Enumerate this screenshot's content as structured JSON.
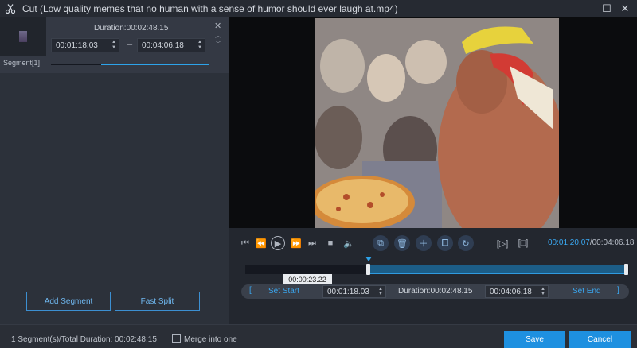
{
  "window": {
    "title": "Cut (Low quality memes that no human with a sense of humor should ever laugh at.mp4)",
    "app_icon": "scissors-icon",
    "minimize": "–",
    "maximize": "☐",
    "close": "✕"
  },
  "segment": {
    "label": "Segment[1]",
    "duration": "Duration:00:02:48.15",
    "start_time": "00:01:18.03",
    "end_time": "00:04:06.18",
    "separator": "–",
    "close": "✕",
    "up": "︿",
    "down": "﹀",
    "progress_fraction_start": 0.32,
    "progress_fraction_end": 1.0
  },
  "buttons": {
    "add_segment": "Add Segment",
    "fast_split": "Fast Split",
    "save": "Save",
    "cancel": "Cancel"
  },
  "playback": {
    "current_time": "00:01:20.07",
    "separator": "/",
    "total_time": "00:04:06.18",
    "icons": [
      "skip-start-icon",
      "rewind-icon",
      "play-icon",
      "forward-icon",
      "skip-end-icon",
      "stop-icon",
      "volume-icon",
      "split-icon",
      "delete-icon",
      "add-icon",
      "copy-icon",
      "reset-icon",
      "mark-in-icon",
      "mark-out-icon"
    ]
  },
  "timeline": {
    "hover_time": "00:00:23.22",
    "selection_start_fraction": 0.32,
    "selection_end_fraction": 1.0
  },
  "edit_bar": {
    "set_start": "Set Start",
    "start_time": "00:01:18.03",
    "duration": "Duration:00:02:48.15",
    "end_time": "00:04:06.18",
    "set_end": "Set End",
    "bracket_left": "[",
    "bracket_right": "]"
  },
  "footer": {
    "status": "1 Segment(s)/Total Duration: 00:02:48.15",
    "merge_label": "Merge into one",
    "merge_checked": false
  },
  "colors": {
    "accent": "#1e90e0",
    "accent_text": "#3aa7f0",
    "background": "#23272f",
    "panel": "#2c313a"
  }
}
